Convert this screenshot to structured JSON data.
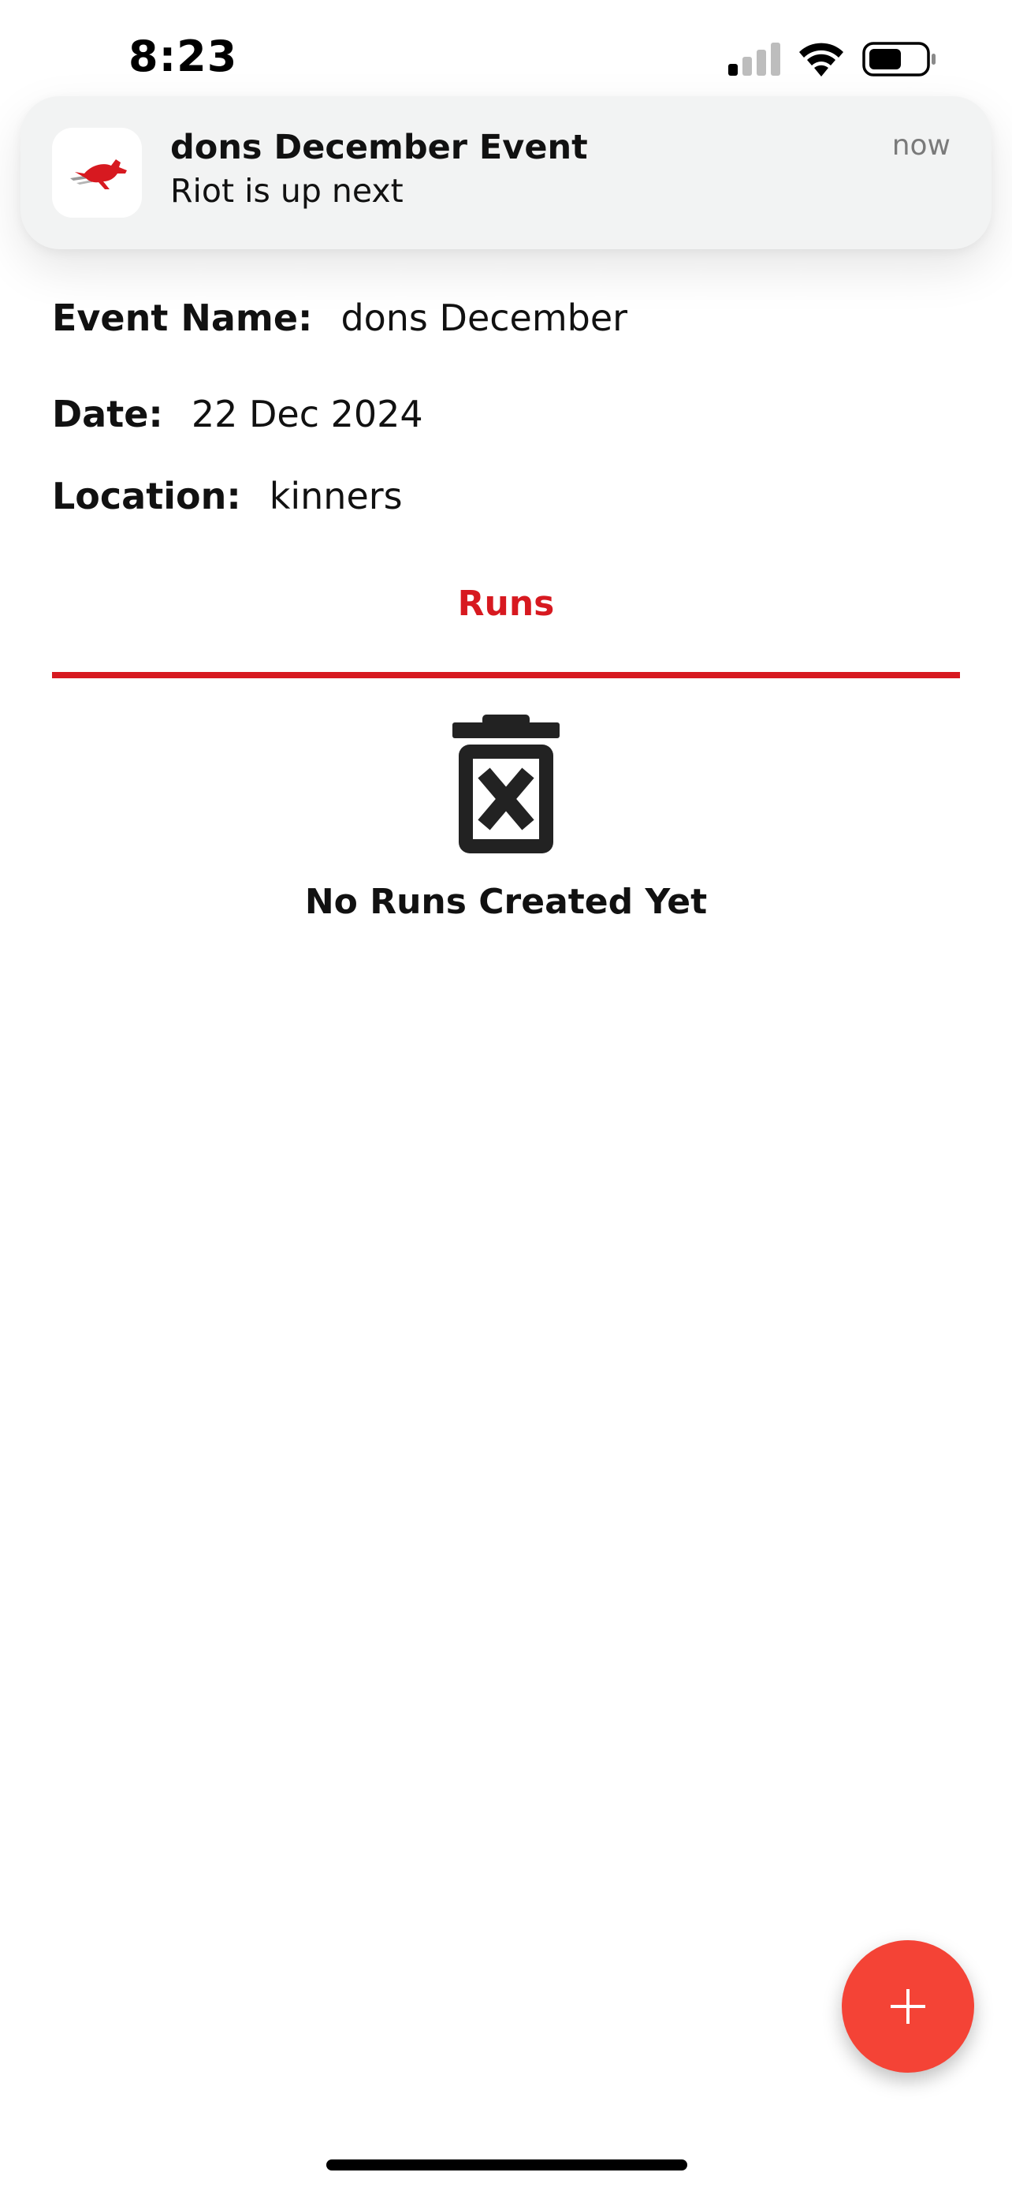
{
  "status_bar": {
    "time": "8:23"
  },
  "notification": {
    "title": "dons December Event",
    "body": "Riot is up next",
    "time": "now"
  },
  "event": {
    "name_label": "Event Name:",
    "name_value": "dons December",
    "date_label": "Date:",
    "date_value": "22 Dec 2024",
    "location_label": "Location:",
    "location_value": "kinners"
  },
  "tabs": [
    {
      "label": "Runs"
    }
  ],
  "empty_state": {
    "icon": "trash-x-icon",
    "message": "No Runs Created Yet"
  },
  "fab": {
    "icon": "plus-icon"
  },
  "colors": {
    "accent": "#d71920",
    "fab": "#f44336"
  }
}
